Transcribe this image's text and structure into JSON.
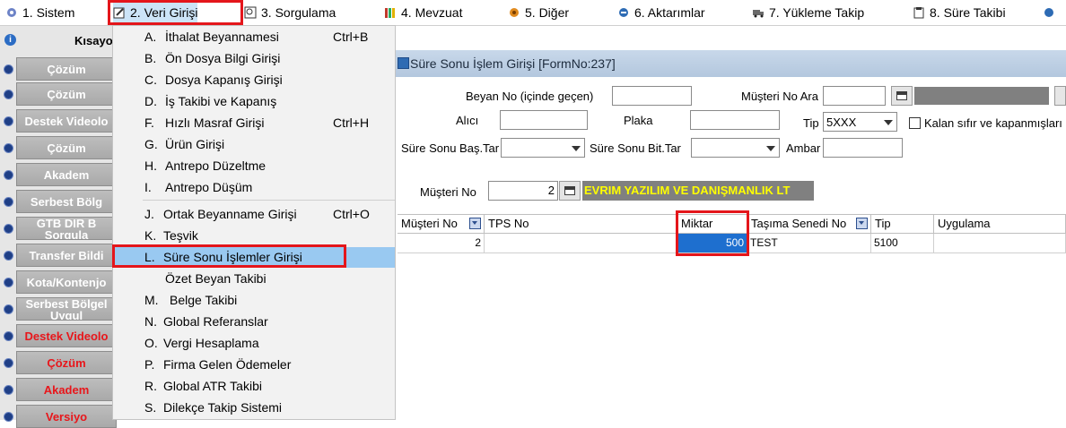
{
  "menubar": {
    "items": [
      {
        "label": "1.  Sistem",
        "icon": "wrench-icon"
      },
      {
        "label": "2.  Veri Girişi",
        "icon": "edit-icon"
      },
      {
        "label": "3.  Sorgulama",
        "icon": "query-icon"
      },
      {
        "label": "4.  Mevzuat",
        "icon": "books-icon"
      },
      {
        "label": "5.  Diğer",
        "icon": "tools-icon"
      },
      {
        "label": "6.  Aktarımlar",
        "icon": "transfer-icon"
      },
      {
        "label": "7.  Yükleme Takip",
        "icon": "truck-icon"
      },
      {
        "label": "8. Süre Takibi",
        "icon": "clipboard-icon"
      }
    ]
  },
  "leftpanel": {
    "header": "Kısayo",
    "buttons": [
      {
        "label": "Çözüm",
        "color": "white"
      },
      {
        "label": "Çözüm",
        "color": "white"
      },
      {
        "label": "Destek Videolo",
        "color": "white"
      },
      {
        "label": "Çözüm",
        "color": "white"
      },
      {
        "label": "Akadem",
        "color": "white"
      },
      {
        "label": "Serbest Bölg",
        "color": "white"
      },
      {
        "label": "GTB DIR B Sorgula",
        "color": "white"
      },
      {
        "label": "Transfer Bildi",
        "color": "white"
      },
      {
        "label": "Kota/Kontenjo",
        "color": "white"
      },
      {
        "label": "Serbest Bölgel Uygul",
        "color": "white"
      },
      {
        "label": "Destek Videolo",
        "color": "red"
      },
      {
        "label": "Çözüm",
        "color": "red"
      },
      {
        "label": "Akadem",
        "color": "red"
      },
      {
        "label": "Versiyo",
        "color": "red"
      }
    ]
  },
  "dropdown": {
    "items": [
      {
        "key": "A.",
        "label": "İthalat Beyannamesi",
        "shortcut": "Ctrl+B"
      },
      {
        "key": "B.",
        "label": "Ön Dosya Bilgi Girişi",
        "shortcut": ""
      },
      {
        "key": "C.",
        "label": "Dosya Kapanış Girişi",
        "shortcut": ""
      },
      {
        "key": "D.",
        "label": "İş Takibi ve Kapanış",
        "shortcut": ""
      },
      {
        "key": "F.",
        "label": "Hızlı Masraf Girişi",
        "shortcut": "Ctrl+H"
      },
      {
        "key": "G.",
        "label": "Ürün Girişi",
        "shortcut": ""
      },
      {
        "key": "H.",
        "label": "Antrepo Düzeltme",
        "shortcut": ""
      },
      {
        "key": "I.",
        "label": "Antrepo Düşüm",
        "shortcut": ""
      },
      {
        "key": "J.",
        "label": "Ortak Beyanname Girişi",
        "shortcut": "Ctrl+O"
      },
      {
        "key": "K.",
        "label": "Teşvik",
        "shortcut": ""
      },
      {
        "key": "L.",
        "label": "Süre Sonu İşlemler Girişi",
        "shortcut": ""
      },
      {
        "key": "",
        "label": "Özet Beyan Takibi",
        "shortcut": ""
      },
      {
        "key": "M.",
        "label": "Belge Takibi",
        "shortcut": ""
      },
      {
        "key": "N.",
        "label": "Global Referanslar",
        "shortcut": ""
      },
      {
        "key": "O.",
        "label": "Vergi Hesaplama",
        "shortcut": ""
      },
      {
        "key": "P.",
        "label": "Firma Gelen Ödemeler",
        "shortcut": ""
      },
      {
        "key": "R.",
        "label": "Global ATR Takibi",
        "shortcut": ""
      },
      {
        "key": "S.",
        "label": "Dilekçe Takip Sistemi",
        "shortcut": ""
      }
    ],
    "highlighted_index": 10
  },
  "form": {
    "title": "Süre Sonu İşlem Girişi [FormNo:237]",
    "labels": {
      "beyan_no": "Beyan No (içinde geçen)",
      "musteri_no_ara": "Müşteri No Ara",
      "alici": "Alıcı",
      "plaka": "Plaka",
      "tip": "Tip",
      "kalan_sifir": "Kalan sıfır ve kapanmışları",
      "sure_sonu_bas": "Süre Sonu Baş.Tar",
      "sure_sonu_bit": "Süre Sonu Bit.Tar",
      "ambar": "Ambar",
      "musteri_no": "Müşteri No"
    },
    "values": {
      "tip": "5XXX",
      "musteri_no": "2",
      "company_name": "EVRIM YAZILIM VE DANIŞMANLIK LT"
    }
  },
  "grid": {
    "columns": [
      "Müşteri No",
      "TPS No",
      "Miktar",
      "Taşıma Senedi No",
      "Tip",
      "Uygulama"
    ],
    "rows": [
      [
        "2",
        "",
        "500",
        "TEST",
        "5100",
        ""
      ]
    ]
  },
  "colors": {
    "highlight": "#99c9f1",
    "annotation_red": "#e4161b",
    "selected_cell": "#1e6fcf",
    "company_text": "#ffff00"
  }
}
